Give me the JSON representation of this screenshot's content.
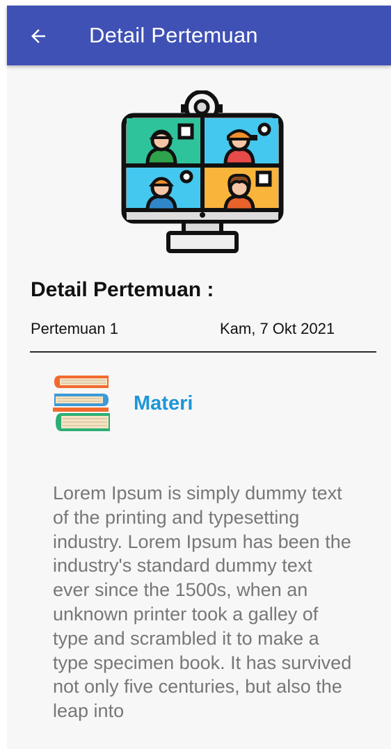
{
  "app_bar": {
    "title": "Detail Pertemuan",
    "back_icon": "arrow-left-icon",
    "color": "#3f51b5"
  },
  "illustration": {
    "icon": "video-conference-monitor-icon"
  },
  "section": {
    "title": "Detail Pertemuan :"
  },
  "meeting": {
    "name": "Pertemuan 1",
    "date": "Kam, 7 Okt 2021"
  },
  "materi": {
    "icon": "books-stack-icon",
    "label": "Materi",
    "color": "#1e96d8"
  },
  "description": {
    "text": "Lorem Ipsum is simply dummy text of the printing and typesetting industry. Lorem Ipsum has been the industry's standard dummy text ever since the 1500s, when an unknown printer took a galley of type and scrambled it to make a type specimen book. It has survived not only five centuries, but also the leap into"
  }
}
